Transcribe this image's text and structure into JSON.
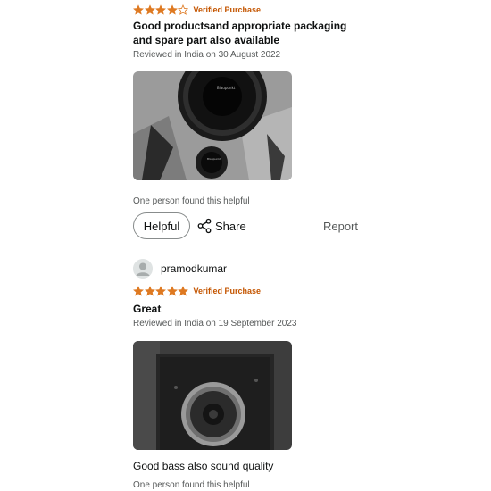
{
  "reviews": [
    {
      "rating": 4,
      "verified_label": "Verified Purchase",
      "title": "Good productsand appropriate packaging and spare part also available",
      "meta": "Reviewed in India on 30 August 2022",
      "helpful_text": "One person found this helpful",
      "helpful_label": "Helpful",
      "share_label": "Share",
      "report_label": "Report"
    },
    {
      "username": "pramodkumar",
      "rating": 5,
      "verified_label": "Verified Purchase",
      "title": "Great",
      "meta": "Reviewed in India on 19 September 2023",
      "body": "Good bass also sound quality",
      "helpful_text": "One person found this helpful"
    }
  ],
  "colors": {
    "star": "#de7921",
    "verified": "#c45500",
    "muted": "#565959"
  },
  "icons": {
    "star": "star-icon",
    "share": "share-icon",
    "avatar": "user-avatar-icon"
  }
}
